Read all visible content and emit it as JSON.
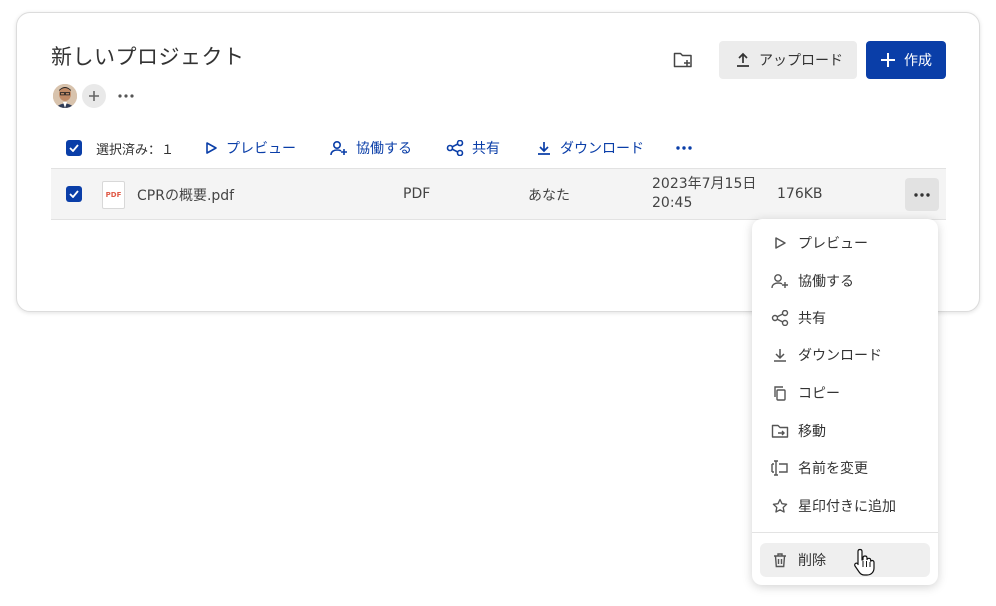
{
  "project": {
    "title": "新しいプロジェクト"
  },
  "header": {
    "upload_label": "アップロード",
    "create_label": "作成"
  },
  "toolbar": {
    "selected_label": "選択済み：１",
    "preview": "プレビュー",
    "collaborate": "協働する",
    "share": "共有",
    "download": "ダウンロード"
  },
  "file_row": {
    "name": "CPRの概要.pdf",
    "type": "PDF",
    "owner": "あなた",
    "date_line1": "2023年7月15日",
    "date_line2": "20:45",
    "size": "176KB",
    "icon_text": "PDF"
  },
  "context_menu": {
    "items": [
      "プレビュー",
      "協働する",
      "共有",
      "ダウンロード",
      "コピー",
      "移動",
      "名前を変更",
      "星印付きに追加"
    ],
    "delete": "削除"
  },
  "colors": {
    "accent": "#0a3ea8",
    "row_bg": "#f4f4f4"
  }
}
